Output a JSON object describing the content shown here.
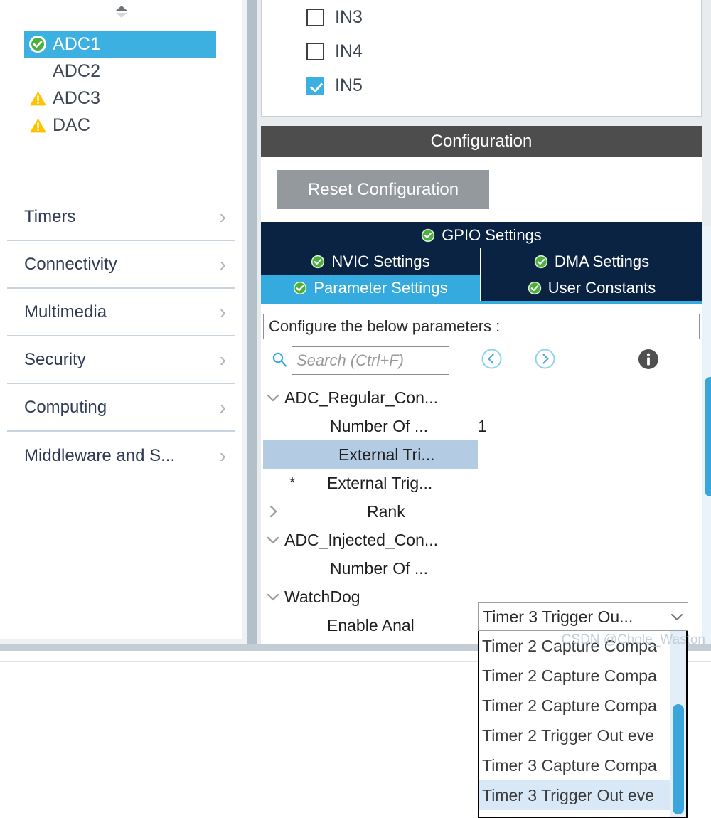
{
  "sidebar": {
    "peripherals": [
      {
        "label": "ADC1",
        "status": "ok",
        "selected": true
      },
      {
        "label": "ADC2",
        "status": "none",
        "selected": false
      },
      {
        "label": "ADC3",
        "status": "warning",
        "selected": false
      },
      {
        "label": "DAC",
        "status": "warning",
        "selected": false
      }
    ],
    "categories": [
      {
        "label": "Timers",
        "chevron": "chevron-right-icon"
      },
      {
        "label": "Connectivity",
        "chevron": "chevron-right-icon"
      },
      {
        "label": "Multimedia",
        "chevron": "chevron-right-icon"
      },
      {
        "label": "Security",
        "chevron": "chevron-right-icon"
      },
      {
        "label": "Computing",
        "chevron": "chevron-right-icon"
      },
      {
        "label": "Middleware and S...",
        "chevron": "chevron-right-icon"
      }
    ]
  },
  "pins": {
    "channels": [
      {
        "label": "IN3",
        "checked": false
      },
      {
        "label": "IN4",
        "checked": false
      },
      {
        "label": "IN5",
        "checked": true
      }
    ]
  },
  "config": {
    "header_title": "Configuration",
    "reset_button": "Reset Configuration",
    "tabs": [
      {
        "label": "GPIO Settings",
        "status": "ok",
        "active": false,
        "width": "full"
      },
      {
        "label": "NVIC Settings",
        "status": "ok",
        "active": false,
        "width": "half"
      },
      {
        "label": "DMA Settings",
        "status": "ok",
        "active": false,
        "width": "half"
      },
      {
        "label": "Parameter Settings",
        "status": "ok",
        "active": true,
        "width": "half"
      },
      {
        "label": "User Constants",
        "status": "ok",
        "active": false,
        "width": "half"
      }
    ],
    "configure_label": "Configure the below parameters :",
    "search": {
      "placeholder": "Search (Ctrl+F)",
      "value": "",
      "icon": "search-icon",
      "prev_icon": "circle-left-arrow-icon",
      "next_icon": "circle-right-arrow-icon",
      "info_icon": "info-icon"
    },
    "tree": [
      {
        "name": "ADC_Regular_Con...",
        "value": "",
        "arrow": "chevron-down-icon",
        "indent": 0,
        "selected": false,
        "star": false
      },
      {
        "name": "Number Of ...",
        "value": "1",
        "arrow": "none",
        "indent": 1,
        "selected": false,
        "star": false
      },
      {
        "name": "External Tri...",
        "value": "",
        "arrow": "none",
        "indent": 1,
        "selected": true,
        "star": false
      },
      {
        "name": "External Trig...",
        "value": "",
        "arrow": "none",
        "indent": 1,
        "selected": false,
        "star": true
      },
      {
        "name": "Rank",
        "value": "",
        "arrow": "chevron-right-icon",
        "indent": 1,
        "selected": false,
        "star": false
      },
      {
        "name": "ADC_Injected_Con...",
        "value": "",
        "arrow": "chevron-down-icon",
        "indent": 0,
        "selected": false,
        "star": false
      },
      {
        "name": "Number Of ...",
        "value": "",
        "arrow": "none",
        "indent": 1,
        "selected": false,
        "star": false
      },
      {
        "name": "WatchDog",
        "value": "",
        "arrow": "chevron-down-icon",
        "indent": 0,
        "selected": false,
        "star": false
      },
      {
        "name": "Enable Anal",
        "value": "",
        "arrow": "none",
        "indent": 1,
        "selected": false,
        "star": false
      }
    ],
    "combo": {
      "selected_text": "Timer 3 Trigger Ou...",
      "chevron": "chevron-down-icon",
      "options": [
        {
          "label": "Timer 2 Capture Compa",
          "selected": false
        },
        {
          "label": "Timer 2 Capture Compa",
          "selected": false
        },
        {
          "label": "Timer 2 Capture Compa",
          "selected": false
        },
        {
          "label": "Timer 2 Trigger Out eve",
          "selected": false
        },
        {
          "label": "Timer 3 Capture Compa",
          "selected": false
        },
        {
          "label": "Timer 3 Trigger Out eve",
          "selected": true
        }
      ]
    }
  },
  "watermark": "CSDN @Chole_Waston",
  "colors": {
    "accent_blue": "#35aade",
    "tab_navy": "#0b2342",
    "selection_blue": "#b4cbe4",
    "warning_yellow": "#fdc300",
    "ok_green": "#4caf3f",
    "header_gray": "#4d4d4d",
    "splitter_gray": "#b4c0c9"
  }
}
